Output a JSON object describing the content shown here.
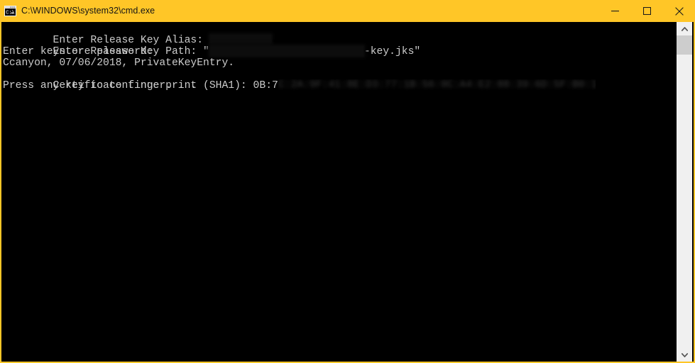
{
  "window": {
    "title": "C:\\WINDOWS\\system32\\cmd.exe",
    "icon": "cmd-console-icon",
    "titlebar_color": "#ffc627",
    "console_background": "#000000",
    "console_text_color": "#cccccc"
  },
  "caption_buttons": {
    "minimize": "minimize",
    "maximize": "maximize",
    "close": "close"
  },
  "console": {
    "lines": [
      {
        "id": "line-key-alias",
        "prefix": "Enter Release Key Alias: ",
        "redacted": true,
        "suffix": ""
      },
      {
        "id": "line-key-path",
        "prefix": "Enter Release Key Path: \"",
        "redacted": true,
        "suffix": "-key.jks\""
      },
      {
        "id": "line-keystore-password",
        "prefix": "Enter keystore password:",
        "redacted": false,
        "suffix": ""
      },
      {
        "id": "line-certificate-entry",
        "prefix": "Ccanyon, 07/06/2018, PrivateKeyEntry.",
        "redacted": false,
        "suffix": ""
      },
      {
        "id": "line-fingerprint",
        "prefix": "Certificate fingerprint (SHA1): 0B:7",
        "redacted": true,
        "suffix": ""
      },
      {
        "id": "line-press-any-key",
        "prefix": "Press any key to continue . . .",
        "redacted": false,
        "suffix": ""
      }
    ],
    "line_1_prefix": "Enter Release Key Alias: ",
    "line_2_prefix": "Enter Release Key Path: \"",
    "line_2_suffix": "-key.jks\"",
    "line_3": "Enter keystore password:",
    "line_4": "Ccanyon, 07/06/2018, PrivateKeyEntry.",
    "line_5_prefix": "Certificate fingerprint (SHA1): 0B:7",
    "line_5_blurred": "C:2A:9F:41:8E:D3:77:1B:56:0C:A4:E2:88:39:6D:5F:B0:17",
    "line_6": "Press any key to continue . . ."
  },
  "scrollbar": {
    "up_arrow": "scroll-up",
    "down_arrow": "scroll-down",
    "thumb": "scroll-thumb"
  }
}
